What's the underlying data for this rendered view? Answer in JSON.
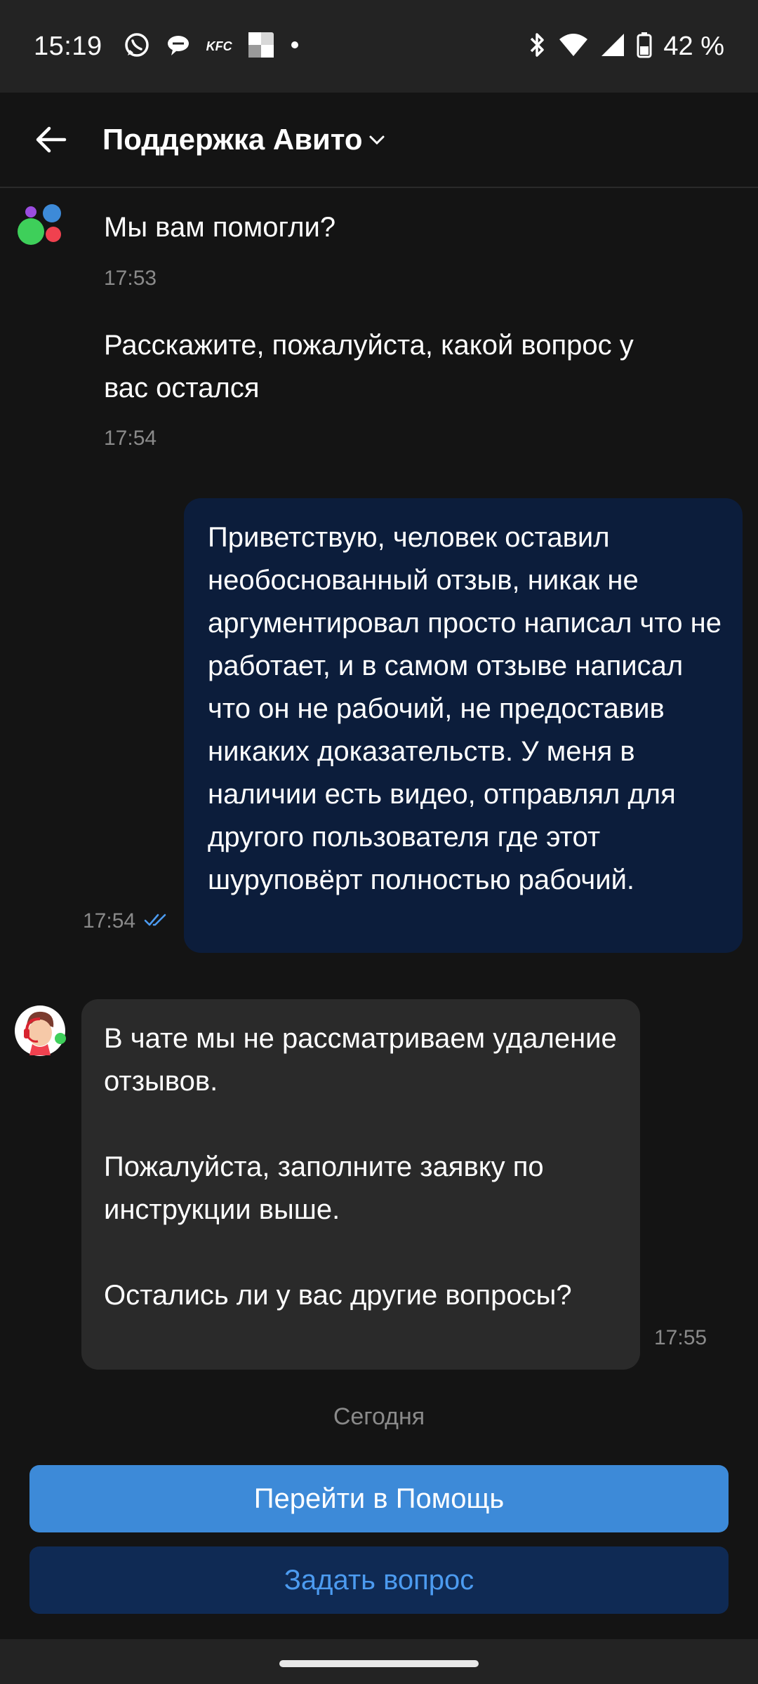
{
  "status_bar": {
    "time": "15:19",
    "left_icons": [
      "whatsapp-icon",
      "chat-bubble-icon",
      "kfc-icon",
      "app-icon",
      "dot-icon"
    ],
    "kfc_text": "KFC",
    "right_icons": [
      "bluetooth-icon",
      "wifi-icon",
      "signal-icon",
      "battery-icon"
    ],
    "battery": "42 %"
  },
  "header": {
    "title": "Поддержка Авито"
  },
  "messages": [
    {
      "from": "bot",
      "text": "Мы вам помогли?",
      "time": "17:53"
    },
    {
      "from": "bot",
      "text": "Расскажите, пожалуйста, какой вопрос у вас остался",
      "time": "17:54"
    },
    {
      "from": "user",
      "text": "Приветствую, человек оставил необоснованный отзыв, никак не аргументировал просто написал что не работает, и в самом отзыве написал что он не рабочий, не предоставив никаких доказательств. У меня в наличии есть видео, отправлял для другого пользователя где этот шуруповёрт полностью рабочий.",
      "time": "17:54",
      "status": "read"
    },
    {
      "from": "agent",
      "paragraphs": [
        "В чате мы не рассматриваем удаление отзывов.",
        "Пожалуйста, заполните заявку по инструкции выше.",
        "Остались ли у вас другие вопросы?"
      ],
      "time": "17:55"
    }
  ],
  "date_separator": "Сегодня",
  "actions": {
    "primary": "Перейти в Помощь",
    "secondary": "Задать вопрос"
  },
  "colors": {
    "background": "#141414",
    "user_bubble": "#0c1d3b",
    "agent_bubble": "#2a2a2a",
    "primary_button": "#3d8ad8",
    "secondary_button": "#0f2a54",
    "secondary_text": "#4c9bf0"
  }
}
